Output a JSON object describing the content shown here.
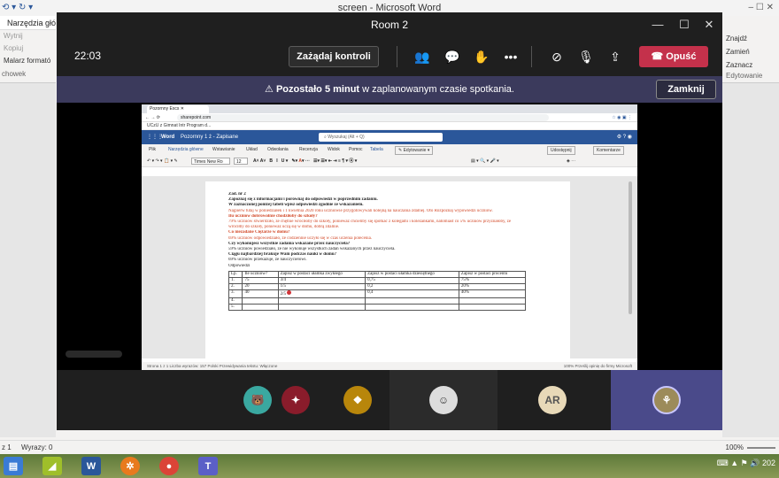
{
  "word_bg": {
    "title": "screen  -  Microsoft Word",
    "ribbon_left": {
      "tab": "Narzędzia głów",
      "items": [
        "Wytnij",
        "Kopiuj",
        "Malarz formató"
      ],
      "group": "chowek"
    },
    "ribbon_right": {
      "items": [
        "Znajdź",
        "Zamień",
        "Zaznacz"
      ],
      "group": "Edytowanie"
    },
    "status": {
      "page": "z 1",
      "words": "Wyrazy: 0",
      "zoom": "100%"
    }
  },
  "taskbar": {
    "clock": "202"
  },
  "teams": {
    "title": "Room 2",
    "time": "22:03",
    "request_control": "Zażądaj kontroli",
    "leave": "Opuść",
    "banner": {
      "bold": "Pozostało 5 minut",
      "text": "w zaplanowanym czasie spotkania.",
      "close": "Zamknij"
    },
    "participants": [
      {
        "initials": ""
      },
      {
        "initials": ""
      },
      {
        "initials": ""
      },
      {
        "initials": ""
      },
      {
        "initials": "AR"
      },
      {
        "initials": ""
      }
    ]
  },
  "shared": {
    "browser_tab": "Pozornny Excs",
    "url": "sharepoint.com",
    "bookmarks": "UCzU z Gimnat    Intr    Program d...",
    "wo_app": "Word",
    "wo_doc": "Pozornny 1 ż - Zapisane",
    "wo_search": "Wyszukaj (Alt + Q)",
    "wo_tabs": [
      "Plik",
      "Narzędzia główne",
      "Wstawianie",
      "Układ",
      "Odwołania",
      "Recenzja",
      "Widok",
      "Pomoc",
      "Tabela"
    ],
    "wo_editing": "Edytowanie",
    "wo_share": "Udostępnij",
    "wo_comments": "Komentarze",
    "font_name": "Times New Ro",
    "font_size": "12",
    "doc_lines": [
      {
        "text": "Zad. nr 2",
        "style": "b"
      },
      {
        "text": "Zapoznaj się z informacjami i porównaj do odpowiedzi w poprzednim zadaniu.",
        "style": "b"
      },
      {
        "text": "W zaznaczonej poniżej tabeli wpisz odpowiedzi zgodnie ze wskazaniem.",
        "style": "b"
      },
      {
        "text": "Najpierw tutaj w poniedziałek i 1 kwietnia 2020 roku uczniowie przygotowywali kolejną na nauczania zdalnej. Oto Rozpoznaj wypowiedzi uczniów.",
        "style": "red"
      },
      {
        "text": "Ilu uczniów dobrowolnie chodziłoby do szkoły?",
        "style": "red b"
      },
      {
        "text": "79% uczniów stwierdziło, że chętnie wróciłoby do szkoły, ponieważ chcieliby się spotkać z kolegami i koleżankami, natomiast co 5% uczniów przyznałoby, że",
        "style": "red"
      },
      {
        "text": "wróciłby do szkoły, ponieważ uczą się w domu, dobrą zdalnie.",
        "style": "red"
      },
      {
        "text": "Co niezadane Ciężarze w domu?",
        "style": "red b"
      },
      {
        "text": "69% uczniów odpowiedziało, że codziennie uczyło się w czas uczenia polecenia.",
        "style": "red"
      },
      {
        "text": "Czy wykonujesz wszystkie zadania wskazane przez nauczyciela?",
        "style": "b"
      },
      {
        "text": "59% uczniów powiedziało, że nie wykonuje wszystkich zadań wskazanych przez nauczyciela.",
        "style": ""
      },
      {
        "text": "Ciągu najbardziej brakuje Wam podczas nauki w domu?",
        "style": "b"
      },
      {
        "text": "69% uczniów przekazuje, że nauczycielowi.",
        "style": ""
      },
      {
        "text": "Odpowiedzi",
        "style": ""
      }
    ],
    "table": {
      "header": [
        "Lp.",
        "Ile uczniów?",
        "Zapisz w postaci ułamka zwykłego",
        "Zapisz w postaci ułamka dziesiętnego",
        "Zapisz w postaci procentu"
      ],
      "rows": [
        [
          "1.",
          "75",
          "3/4",
          "0,75",
          "75%"
        ],
        [
          "2.",
          "20",
          "1/5",
          "0,2",
          "20%"
        ],
        [
          "3.",
          "40",
          "2/5",
          "0,4",
          "40%"
        ],
        [
          "4.",
          "",
          "",
          "",
          ""
        ],
        [
          "5.",
          "",
          "",
          "",
          ""
        ]
      ]
    },
    "wo_status": "Strona 1 z 1    Liczba wyrazów: 157    Polski    Przewidywania tekstu: Włączone",
    "wo_status_right": "100%    Prześlij opinię do firmy Microsoft"
  }
}
